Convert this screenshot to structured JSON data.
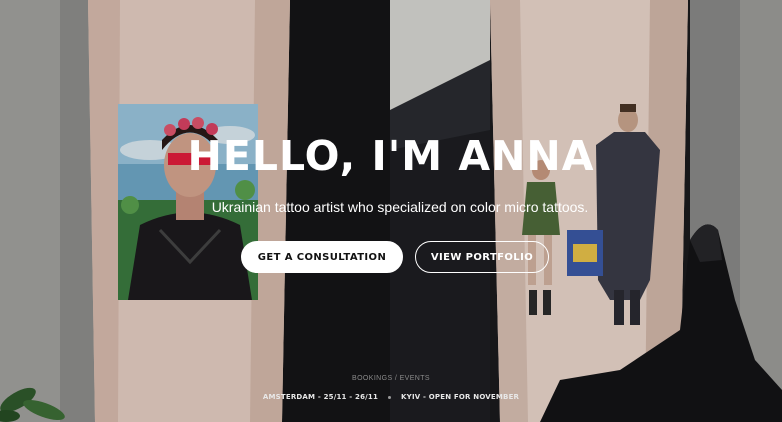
{
  "hero": {
    "title": "HELLO, I'M ANNA",
    "subtitle": "Ukrainian tattoo artist who specialized on color micro tattoos.",
    "buttons": {
      "consultation": "GET A CONSULTATION",
      "portfolio": "VIEW PORTFOLIO"
    }
  },
  "events": {
    "label": "BOOKINGS / EVENTS",
    "items": [
      "AMSTERDAM - 25/11 - 26/11",
      "KYIV - OPEN FOR NOVEMBER"
    ]
  },
  "colors": {
    "text": "#ffffff",
    "button_bg": "#ffffff",
    "button_text": "#111111",
    "muted": "#8a8a8a"
  }
}
